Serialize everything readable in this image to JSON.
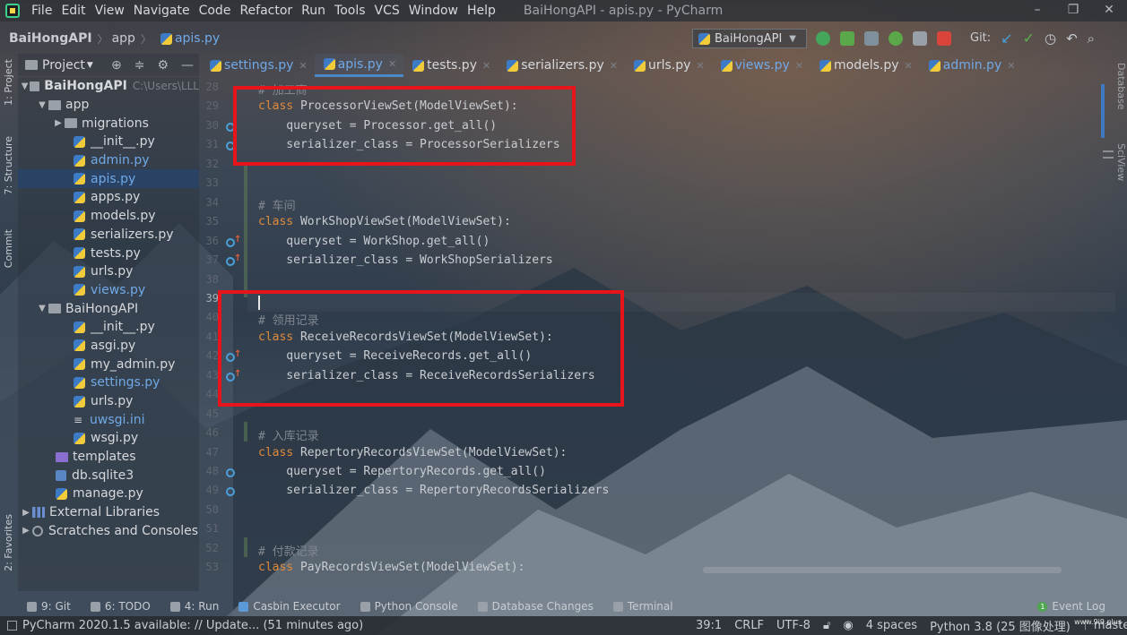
{
  "menubar": {
    "items": [
      "File",
      "Edit",
      "View",
      "Navigate",
      "Code",
      "Refactor",
      "Run",
      "Tools",
      "VCS",
      "Window",
      "Help"
    ],
    "window_title": "BaiHongAPI - apis.py - PyCharm"
  },
  "navbar": {
    "project": "BaiHongAPI",
    "folder": "app",
    "file": "apis.py",
    "run_config": "BaiHongAPI",
    "git_label": "Git:"
  },
  "left_strip": {
    "project_tab": "1: Project",
    "structure_tab": "7: Structure",
    "commit_tab": "Commit",
    "favorites_tab": "2: Favorites"
  },
  "right_strip": {
    "database_tab": "Database",
    "sciview_tab": "SciView"
  },
  "project_panel": {
    "title": "Project",
    "tree": [
      {
        "label": "BaiHongAPI",
        "hint": "C:\\Users\\LLL"
      },
      {
        "label": "app"
      },
      {
        "label": "migrations"
      },
      {
        "label": "__init__.py"
      },
      {
        "label": "admin.py"
      },
      {
        "label": "apis.py"
      },
      {
        "label": "apps.py"
      },
      {
        "label": "models.py"
      },
      {
        "label": "serializers.py"
      },
      {
        "label": "tests.py"
      },
      {
        "label": "urls.py"
      },
      {
        "label": "views.py"
      },
      {
        "label": "BaiHongAPI"
      },
      {
        "label": "__init__.py"
      },
      {
        "label": "asgi.py"
      },
      {
        "label": "my_admin.py"
      },
      {
        "label": "settings.py"
      },
      {
        "label": "urls.py"
      },
      {
        "label": "uwsgi.ini"
      },
      {
        "label": "wsgi.py"
      },
      {
        "label": "templates"
      },
      {
        "label": "db.sqlite3"
      },
      {
        "label": "manage.py"
      },
      {
        "label": "External Libraries"
      },
      {
        "label": "Scratches and Consoles"
      }
    ]
  },
  "tabs": [
    "settings.py",
    "apis.py",
    "tests.py",
    "serializers.py",
    "urls.py",
    "views.py",
    "models.py",
    "admin.py"
  ],
  "editor": {
    "line_numbers": [
      "28",
      "29",
      "30",
      "31",
      "32",
      "33",
      "34",
      "35",
      "36",
      "37",
      "38",
      "39",
      "40",
      "41",
      "42",
      "43",
      "44",
      "45",
      "46",
      "47",
      "48",
      "49",
      "50",
      "51",
      "52",
      "53"
    ],
    "lines": [
      {
        "kw": "",
        "text": "# 加工商",
        "comment": true
      },
      {
        "kw": "class ",
        "text": "ProcessorViewSet(ModelViewSet):"
      },
      {
        "kw": "",
        "text": "    queryset = Processor.get_all()"
      },
      {
        "kw": "",
        "text": "    serializer_class = ProcessorSerializers"
      },
      {
        "kw": "",
        "text": ""
      },
      {
        "kw": "",
        "text": ""
      },
      {
        "kw": "",
        "text": "# 车间",
        "comment": true
      },
      {
        "kw": "class ",
        "text": "WorkShopViewSet(ModelViewSet):"
      },
      {
        "kw": "",
        "text": "    queryset = WorkShop.get_all()"
      },
      {
        "kw": "",
        "text": "    serializer_class = WorkShopSerializers"
      },
      {
        "kw": "",
        "text": ""
      },
      {
        "kw": "",
        "text": ""
      },
      {
        "kw": "",
        "text": "# 领用记录",
        "comment": true
      },
      {
        "kw": "class ",
        "text": "ReceiveRecordsViewSet(ModelViewSet):"
      },
      {
        "kw": "",
        "text": "    queryset = ReceiveRecords.get_all()"
      },
      {
        "kw": "",
        "text": "    serializer_class = ReceiveRecordsSerializers"
      },
      {
        "kw": "",
        "text": ""
      },
      {
        "kw": "",
        "text": ""
      },
      {
        "kw": "",
        "text": "# 入库记录",
        "comment": true
      },
      {
        "kw": "class ",
        "text": "RepertoryRecordsViewSet(ModelViewSet):"
      },
      {
        "kw": "",
        "text": "    queryset = RepertoryRecords.get_all()"
      },
      {
        "kw": "",
        "text": "    serializer_class = RepertoryRecordsSerializers"
      },
      {
        "kw": "",
        "text": ""
      },
      {
        "kw": "",
        "text": ""
      },
      {
        "kw": "",
        "text": "# 付款记录",
        "comment": true
      },
      {
        "kw": "class ",
        "text": "PayRecordsViewSet(ModelViewSet):"
      }
    ]
  },
  "bottom_tools": [
    "9: Git",
    "6: TODO",
    "4: Run",
    "Casbin Executor",
    "Python Console",
    "Database Changes",
    "Terminal"
  ],
  "event_log": "Event Log",
  "status": {
    "message": "PyCharm 2020.1.5 available: // Update... (51 minutes ago)",
    "position": "39:1",
    "line_sep": "CRLF",
    "encoding": "UTF-8",
    "indent": "4 spaces",
    "interpreter": "Python 3.8 (25 图像处理)",
    "branch": "master"
  },
  "colors": {
    "highlight_box": "#e8141c",
    "keyword": "#e08a3a",
    "link_blue": "#70a9e8"
  }
}
